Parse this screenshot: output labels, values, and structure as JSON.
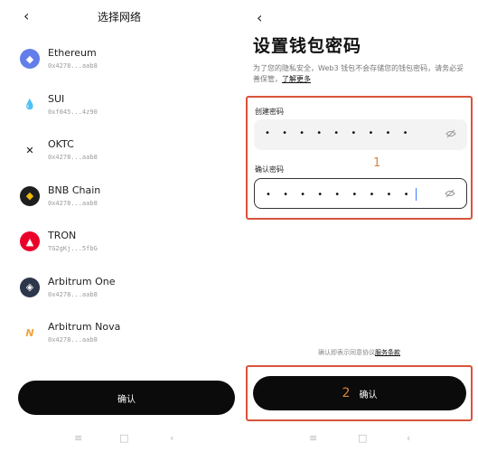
{
  "left": {
    "title": "选择网络",
    "networks": [
      {
        "name": "Ethereum",
        "address": "0x4278...aab8",
        "icon": "ethereum-icon",
        "color": "#627eea",
        "glyph": "◆"
      },
      {
        "name": "SUI",
        "address": "0xf045...4z90",
        "icon": "sui-icon",
        "color": "#ffffff",
        "glyph": "💧"
      },
      {
        "name": "OKTC",
        "address": "0x4278...aab8",
        "icon": "oktc-icon",
        "color": "#ffffff",
        "glyph": "✕"
      },
      {
        "name": "BNB Chain",
        "address": "0x4278...aab8",
        "icon": "bnb-icon",
        "color": "#1e1e1e",
        "glyph": "◆"
      },
      {
        "name": "TRON",
        "address": "TG2gKj...5fbG",
        "icon": "tron-icon",
        "color": "#eb0029",
        "glyph": "▲"
      },
      {
        "name": "Arbitrum One",
        "address": "0x4278...aab8",
        "icon": "arbitrum-one-icon",
        "color": "#2d374b",
        "glyph": "◈"
      },
      {
        "name": "Arbitrum Nova",
        "address": "0x4278...aab8",
        "icon": "arbitrum-nova-icon",
        "color": "#ffffff",
        "glyph": "N"
      }
    ],
    "confirm_label": "确认"
  },
  "right": {
    "title": "设置钱包密码",
    "description": "为了您的隐私安全，Web3 钱包不会存储您的钱包密码，请务必妥善保管，",
    "learn_more": "了解更多",
    "create_label": "创建密码",
    "create_value": "• • • • • • • • •",
    "confirm_pw_label": "确认密码",
    "confirm_pw_value": "• • • • • • • • •",
    "annotation_1": "1",
    "agreement_text": "确认即表示同意协议",
    "agreement_link": "服务条款",
    "annotation_2": "2",
    "confirm_label": "确认"
  },
  "system": {
    "menu": "≡",
    "home": "□",
    "back": "‹"
  },
  "colors": {
    "accent_red": "#d9533b",
    "annotation": "#d9853b",
    "button": "#0b0b0b"
  }
}
